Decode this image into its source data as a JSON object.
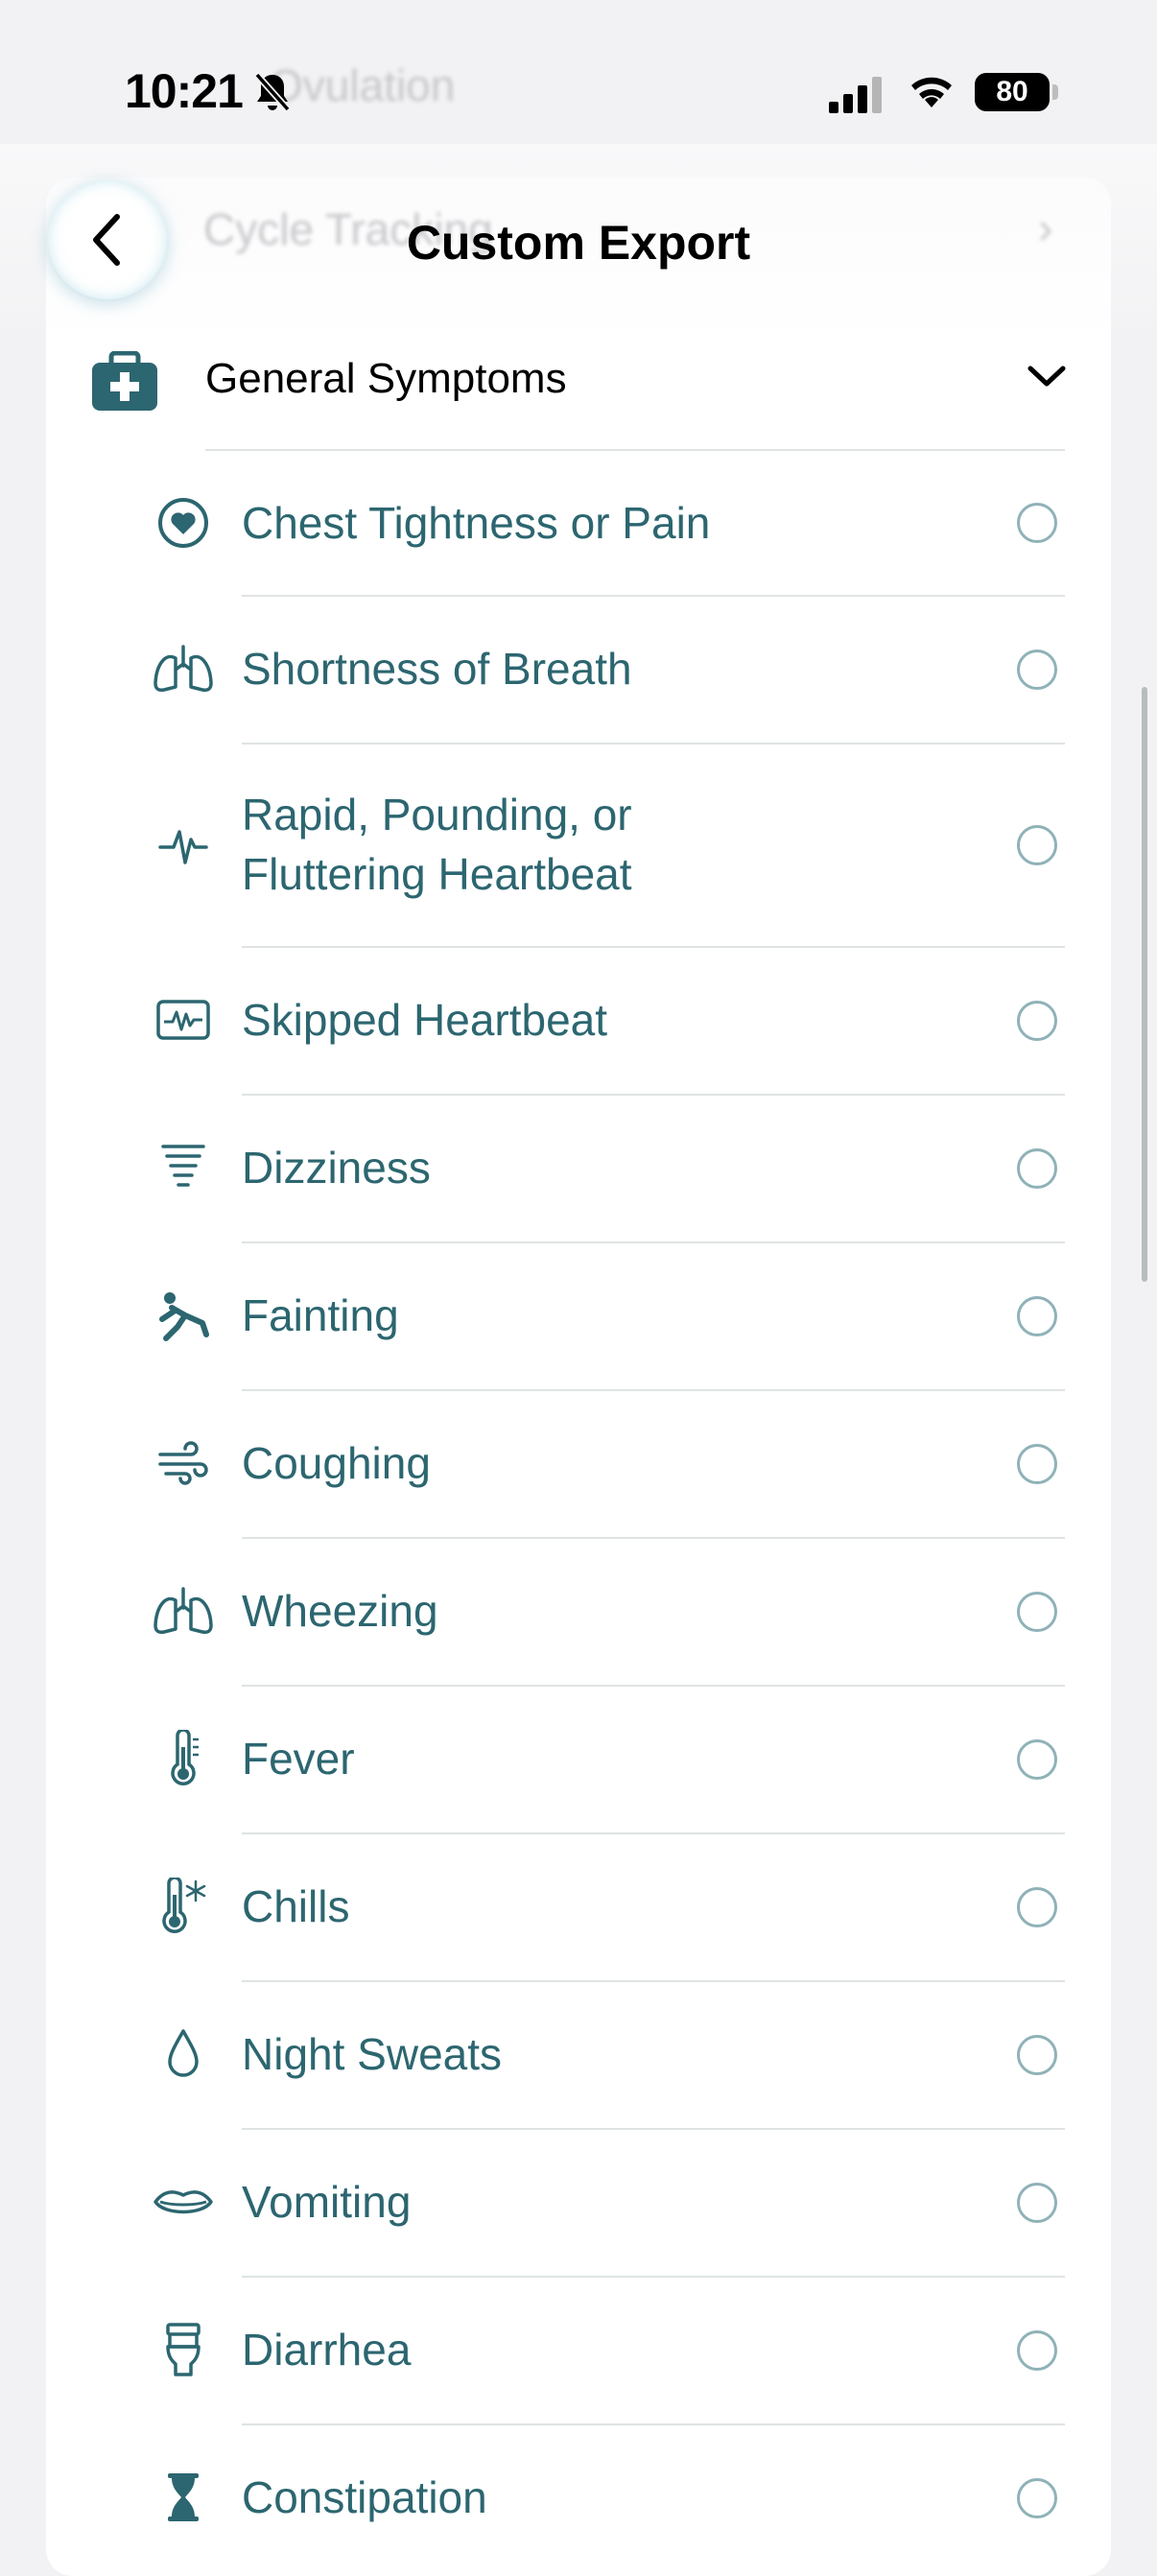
{
  "status_bar": {
    "time": "10:21",
    "battery": "80"
  },
  "nav": {
    "title": "Custom Export",
    "back_icon": "chevron-left-icon"
  },
  "background_rows": [
    "Ovulation",
    "Cycle Tracking"
  ],
  "section": {
    "label": "General Symptoms",
    "icon": "medical-kit-icon",
    "expanded_icon": "chevron-down-icon"
  },
  "colors": {
    "accent": "#2c6670",
    "radio": "#8fb2b8",
    "divider": "#dfe3e4",
    "background": "#f2f2f4"
  },
  "items": [
    {
      "label": "Chest Tightness or Pain",
      "icon": "heart-circle-icon",
      "selected": false
    },
    {
      "label": "Shortness of Breath",
      "icon": "lungs-icon",
      "selected": false
    },
    {
      "label": "Rapid, Pounding, or",
      "label_line2": "Fluttering Heartbeat",
      "icon": "waveform-icon",
      "selected": false
    },
    {
      "label": "Skipped Heartbeat",
      "icon": "waveform-box-icon",
      "selected": false
    },
    {
      "label": "Dizziness",
      "icon": "tornado-icon",
      "selected": false
    },
    {
      "label": "Fainting",
      "icon": "person-falling-icon",
      "selected": false
    },
    {
      "label": "Coughing",
      "icon": "wind-icon",
      "selected": false
    },
    {
      "label": "Wheezing",
      "icon": "lungs-icon",
      "selected": false
    },
    {
      "label": "Fever",
      "icon": "thermometer-icon",
      "selected": false
    },
    {
      "label": "Chills",
      "icon": "thermometer-snowflake-icon",
      "selected": false
    },
    {
      "label": "Night Sweats",
      "icon": "drop-icon",
      "selected": false
    },
    {
      "label": "Vomiting",
      "icon": "mouth-icon",
      "selected": false
    },
    {
      "label": "Diarrhea",
      "icon": "toilet-icon",
      "selected": false
    },
    {
      "label": "Constipation",
      "icon": "hourglass-icon",
      "selected": false
    }
  ]
}
